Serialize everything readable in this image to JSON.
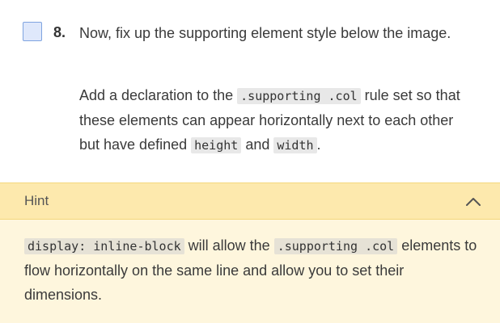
{
  "step": {
    "number": "8.",
    "title": "Now, fix up the supporting element style below the image.",
    "body": {
      "part1": "Add a declaration to the ",
      "code1": ".supporting .col",
      "part2": " rule set so that these elements can appear horizontally next to each other but have defined ",
      "code2": "height",
      "part3": " and ",
      "code3": "width",
      "part4": "."
    }
  },
  "hint": {
    "label": "Hint",
    "icon": "chevron-up-icon",
    "code1": "display: inline-block",
    "part1": " will allow the ",
    "code2": ".supporting .col",
    "part2": " elements to flow horizontally on the same line and allow you to set their dimensions."
  },
  "colors": {
    "hint_header_bg": "#fde9ad",
    "hint_body_bg": "#fef6dd",
    "checkbox_bg": "#dfe8fb",
    "checkbox_border": "#7fa4e0"
  }
}
